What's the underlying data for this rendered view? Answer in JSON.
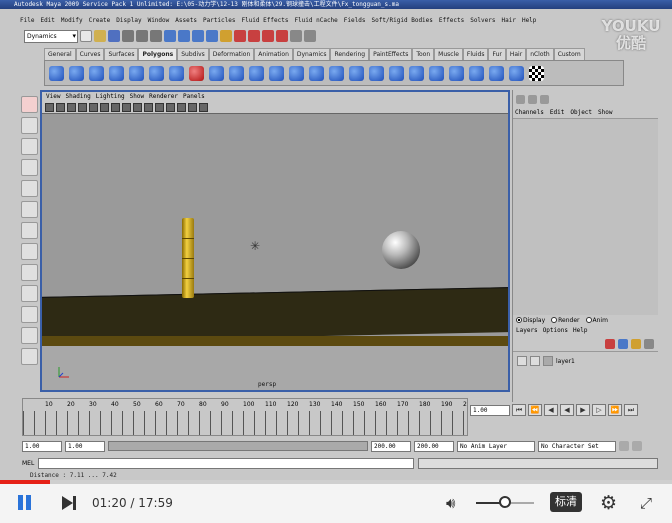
{
  "window": {
    "title": "Autodesk Maya 2009 Service Pack 1 Unlimited: E:\\05-动力学\\12-13 刚体和柔体\\29.钢球撞击\\工程文件\\Fx_tongguan_s.ma"
  },
  "menu": [
    "File",
    "Edit",
    "Modify",
    "Create",
    "Display",
    "Window",
    "Assets",
    "Particles",
    "Fluid Effects",
    "Fluid nCache",
    "Fields",
    "Soft/Rigid Bodies",
    "Effects",
    "Solvers",
    "Hair",
    "Help"
  ],
  "status_line": {
    "menu_set": "Dynamics"
  },
  "shelf_tabs": [
    {
      "label": "General",
      "active": false
    },
    {
      "label": "Curves",
      "active": false
    },
    {
      "label": "Surfaces",
      "active": false
    },
    {
      "label": "Polygons",
      "active": true
    },
    {
      "label": "Subdivs",
      "active": false
    },
    {
      "label": "Deformation",
      "active": false
    },
    {
      "label": "Animation",
      "active": false
    },
    {
      "label": "Dynamics",
      "active": false
    },
    {
      "label": "Rendering",
      "active": false
    },
    {
      "label": "PaintEffects",
      "active": false
    },
    {
      "label": "Toon",
      "active": false
    },
    {
      "label": "Muscle",
      "active": false
    },
    {
      "label": "Fluids",
      "active": false
    },
    {
      "label": "Fur",
      "active": false
    },
    {
      "label": "Hair",
      "active": false
    },
    {
      "label": "nCloth",
      "active": false
    },
    {
      "label": "Custom",
      "active": false
    }
  ],
  "panel": {
    "menu": [
      "View",
      "Shading",
      "Lighting",
      "Show",
      "Renderer",
      "Panels"
    ],
    "camera_label": "persp"
  },
  "channel_box": {
    "menu": [
      "Channels",
      "Edit",
      "Object",
      "Show"
    ]
  },
  "layer_editor": {
    "modes": [
      {
        "label": "Display",
        "selected": true
      },
      {
        "label": "Render",
        "selected": false
      },
      {
        "label": "Anim",
        "selected": false
      }
    ],
    "menu": [
      "Layers",
      "Options",
      "Help"
    ],
    "layers": [
      {
        "name": "layer1"
      }
    ]
  },
  "time_slider": {
    "ticks": [
      "10",
      "20",
      "30",
      "40",
      "50",
      "60",
      "70",
      "80",
      "90",
      "100",
      "110",
      "120",
      "130",
      "140",
      "150",
      "160",
      "170",
      "180",
      "190",
      "2"
    ],
    "current_frame": "1.00"
  },
  "range": {
    "start": "1.00",
    "playback_start": "1.00",
    "playback_end": "200.00",
    "end": "200.00",
    "anim_layer": "No Anim Layer",
    "character_set": "No Character Set"
  },
  "command_line": {
    "label": "MEL"
  },
  "help_line": "Distance : 7.11 ... 7.42",
  "watermark": {
    "line1": "YOUKU",
    "line2": "优酷"
  },
  "player": {
    "current_time": "01:20",
    "duration": "17:59",
    "progress_fraction": 0.074,
    "volume_fraction": 0.5,
    "quality_label": "标清"
  }
}
